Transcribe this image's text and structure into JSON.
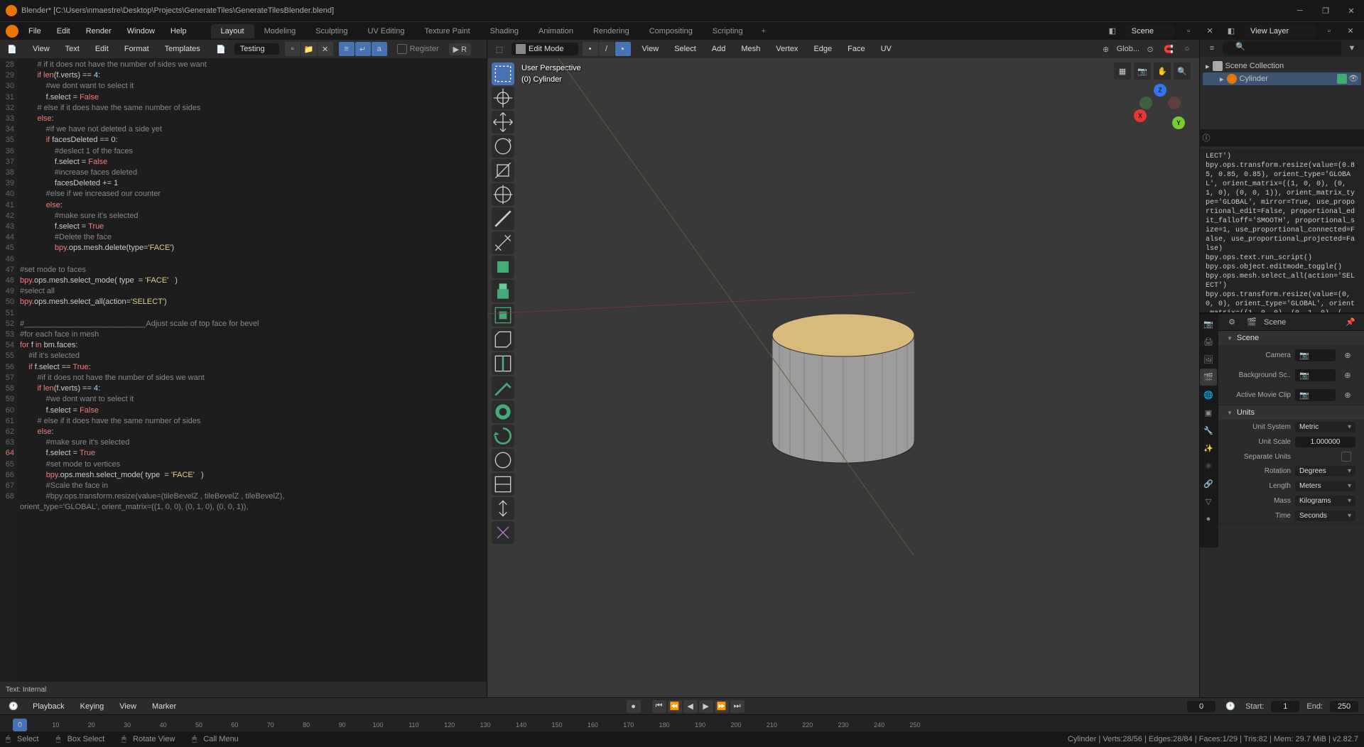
{
  "titlebar": {
    "title": "Blender* [C:\\Users\\nmaestre\\Desktop\\Projects\\GenerateTiles\\GenerateTilesBlender.blend]"
  },
  "topmenu": {
    "items": [
      "File",
      "Edit",
      "Render",
      "Window",
      "Help"
    ],
    "workspaces": [
      "Layout",
      "Modeling",
      "Sculpting",
      "UV Editing",
      "Texture Paint",
      "Shading",
      "Animation",
      "Rendering",
      "Compositing",
      "Scripting"
    ],
    "active_workspace": "Layout",
    "scene": "Scene",
    "view_layer": "View Layer"
  },
  "text_editor": {
    "menus": [
      "View",
      "Text",
      "Edit",
      "Format",
      "Templates"
    ],
    "file": "Testing",
    "register": "Register",
    "run": "R",
    "footer": "Text: Internal",
    "lines": [
      {
        "n": 28,
        "t": "        # if it does not have the number of sides we want",
        "cls": "cm"
      },
      {
        "n": 29,
        "t": "        if len(f.verts) == 4:",
        "mix": true
      },
      {
        "n": 30,
        "t": "            #we dont want to select it",
        "cls": "cm"
      },
      {
        "n": 31,
        "t": "            f.select = False",
        "mix": true
      },
      {
        "n": 32,
        "t": "        # else if it does have the same number of sides",
        "cls": "cm"
      },
      {
        "n": 33,
        "t": "        else:",
        "mix": true
      },
      {
        "n": 34,
        "t": "            #if we have not deleted a side yet",
        "cls": "cm"
      },
      {
        "n": 35,
        "t": "            if facesDeleted == 0:",
        "mix": true
      },
      {
        "n": 36,
        "t": "                #deslect 1 of the faces",
        "cls": "cm"
      },
      {
        "n": 37,
        "t": "                f.select = False",
        "mix": true
      },
      {
        "n": 38,
        "t": "                #increase faces deleted",
        "cls": "cm"
      },
      {
        "n": 39,
        "t": "                facesDeleted += 1",
        "mix": true
      },
      {
        "n": 40,
        "t": "            #else if we increased our counter",
        "cls": "cm"
      },
      {
        "n": 41,
        "t": "            else:",
        "mix": true
      },
      {
        "n": 42,
        "t": "                #make sure it's selected",
        "cls": "cm"
      },
      {
        "n": 43,
        "t": "                f.select = True",
        "mix": true
      },
      {
        "n": 44,
        "t": "                #Delete the face",
        "cls": "cm"
      },
      {
        "n": 45,
        "t": "                bpy.ops.mesh.delete(type='FACE')",
        "mix": true
      },
      {
        "n": 46,
        "t": ""
      },
      {
        "n": 47,
        "t": "#set mode to faces",
        "cls": "cm"
      },
      {
        "n": 48,
        "t": "bpy.ops.mesh.select_mode( type  = 'FACE'   )",
        "mix": true
      },
      {
        "n": 49,
        "t": "#select all",
        "cls": "cm"
      },
      {
        "n": 50,
        "t": "bpy.ops.mesh.select_all(action='SELECT')",
        "mix": true
      },
      {
        "n": 51,
        "t": ""
      },
      {
        "n": 52,
        "t": "#____________________________Adjust scale of top face for bevel",
        "cls": "cm"
      },
      {
        "n": 53,
        "t": "#for each face in mesh",
        "cls": "cm"
      },
      {
        "n": 54,
        "t": "for f in bm.faces:",
        "mix": true
      },
      {
        "n": 55,
        "t": "    #if it's selected",
        "cls": "cm"
      },
      {
        "n": 56,
        "t": "    if f.select == True:",
        "mix": true
      },
      {
        "n": 57,
        "t": "        #if it does not have the number of sides we want",
        "cls": "cm"
      },
      {
        "n": 58,
        "t": "        if len(f.verts) == 4:",
        "mix": true
      },
      {
        "n": 59,
        "t": "            #we dont want to select it",
        "cls": "cm"
      },
      {
        "n": 60,
        "t": "            f.select = False",
        "mix": true
      },
      {
        "n": 61,
        "t": "        # else if it does have the same number of sides",
        "cls": "cm"
      },
      {
        "n": 62,
        "t": "        else:",
        "mix": true
      },
      {
        "n": 63,
        "t": "            #make sure it's selected",
        "cls": "cm"
      },
      {
        "n": 64,
        "t": "            f.select = True",
        "mix": true,
        "hl": true
      },
      {
        "n": 65,
        "t": "            #set mode to vertices",
        "cls": "cm"
      },
      {
        "n": 66,
        "t": "            bpy.ops.mesh.select_mode( type  = 'FACE'   )",
        "mix": true
      },
      {
        "n": 67,
        "t": "            #Scale the face in",
        "cls": "cm"
      },
      {
        "n": 68,
        "t": "            #bpy.ops.transform.resize(value=(tileBevelZ , tileBevelZ , tileBevelZ),",
        "cls": "cm"
      },
      {
        "n": "",
        "t": "orient_type='GLOBAL', orient_matrix=((1, 0, 0), (0, 1, 0), (0, 0, 1)),",
        "cls": "cm"
      }
    ]
  },
  "viewport": {
    "mode": "Edit Mode",
    "menus": [
      "View",
      "Select",
      "Add",
      "Mesh",
      "Vertex",
      "Edge",
      "Face",
      "UV"
    ],
    "overlay_title": "User Perspective",
    "overlay_sub": "(0) Cylinder",
    "global": "Glob..."
  },
  "outliner": {
    "collection": "Scene Collection",
    "items": [
      {
        "name": "Cylinder",
        "type": "mesh"
      }
    ]
  },
  "info_log": "LECT')\nbpy.ops.transform.resize(value=(0.85, 0.85, 0.85), orient_type='GLOBAL', orient_matrix=((1, 0, 0), (0, 1, 0), (0, 0, 1)), orient_matrix_type='GLOBAL', mirror=True, use_proportional_edit=False, proportional_edit_falloff='SMOOTH', proportional_size=1, use_proportional_connected=False, use_proportional_projected=False)\nbpy.ops.text.run_script()\nbpy.ops.object.editmode_toggle()\nbpy.ops.mesh.select_all(action='SELECT')\nbpy.ops.transform.resize(value=(0, 0, 0), orient_type='GLOBAL', orient_matrix=((1, 0, 0), (0, 1, 0), (",
  "properties": {
    "context": "Scene",
    "sections": [
      {
        "title": "Scene",
        "rows": [
          {
            "label": "Camera",
            "type": "field",
            "value": ""
          },
          {
            "label": "Background Sc..",
            "type": "field",
            "value": ""
          },
          {
            "label": "Active Movie Clip",
            "type": "field",
            "value": ""
          }
        ]
      },
      {
        "title": "Units",
        "rows": [
          {
            "label": "Unit System",
            "type": "dropdown",
            "value": "Metric"
          },
          {
            "label": "Unit Scale",
            "type": "number",
            "value": "1.000000"
          },
          {
            "label": "Separate Units",
            "type": "check",
            "value": ""
          },
          {
            "label": "Rotation",
            "type": "dropdown",
            "value": "Degrees"
          },
          {
            "label": "Length",
            "type": "dropdown",
            "value": "Meters"
          },
          {
            "label": "Mass",
            "type": "dropdown",
            "value": "Kilograms"
          },
          {
            "label": "Time",
            "type": "dropdown",
            "value": "Seconds"
          }
        ]
      }
    ]
  },
  "timeline": {
    "menus": [
      "Playback",
      "Keying",
      "View",
      "Marker"
    ],
    "current": "0",
    "start_label": "Start:",
    "start": "1",
    "end_label": "End:",
    "end": "250",
    "ticks": [
      0,
      10,
      20,
      30,
      40,
      50,
      60,
      70,
      80,
      90,
      100,
      110,
      120,
      130,
      140,
      150,
      160,
      170,
      180,
      190,
      200,
      210,
      220,
      230,
      240,
      250
    ]
  },
  "statusbar": {
    "left": [
      {
        "icon": "mouse",
        "text": "Select"
      },
      {
        "icon": "mouse",
        "text": "Box Select"
      },
      {
        "icon": "mouse",
        "text": "Rotate View"
      },
      {
        "icon": "mouse",
        "text": "Call Menu"
      }
    ],
    "right": "Cylinder | Verts:28/56 | Edges:28/84 | Faces:1/29 | Tris:82 | Mem: 29.7 MiB | v2.82.7"
  }
}
